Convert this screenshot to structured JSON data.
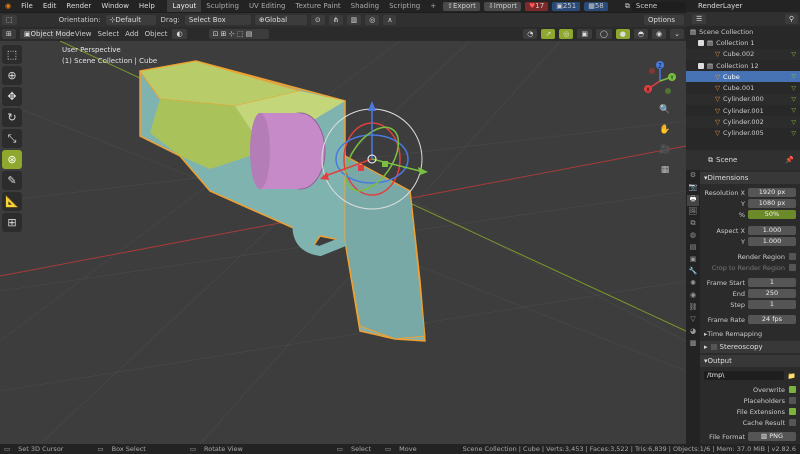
{
  "topbar": {
    "menus": [
      "File",
      "Edit",
      "Render",
      "Window",
      "Help"
    ],
    "workspaces": [
      "Layout",
      "Sculpting",
      "UV Editing",
      "Texture Paint",
      "Shading",
      "Scripting"
    ],
    "active_workspace": "Layout",
    "export_label": "Export",
    "import_label": "Import",
    "stats": [
      "17",
      "251",
      "58"
    ],
    "scene_label": "Scene",
    "view_layer_label": "RenderLayer"
  },
  "header1": {
    "orientation_label": "Orientation:",
    "orientation_value": "Default",
    "drag_label": "Drag:",
    "drag_value": "Select Box",
    "transform_value": "Global",
    "options_label": "Options"
  },
  "header2": {
    "mode": "Object Mode",
    "menus": [
      "View",
      "Select",
      "Add",
      "Object"
    ]
  },
  "viewport": {
    "perspective": "User Perspective",
    "context": "(1) Scene Collection | Cube",
    "gizmo_labels": {
      "x": "X",
      "y": "Y",
      "z": "Z"
    }
  },
  "outliner": {
    "header": "Scene Collection",
    "rows": [
      {
        "label": "Collection 1",
        "type": "collection",
        "indent": 1
      },
      {
        "label": "Cube.002",
        "type": "mesh",
        "indent": 2
      },
      {
        "label": "Collection 12",
        "type": "collection",
        "indent": 1
      },
      {
        "label": "Cube",
        "type": "mesh",
        "indent": 2,
        "selected": true
      },
      {
        "label": "Cube.001",
        "type": "mesh",
        "indent": 2
      },
      {
        "label": "Cylinder.000",
        "type": "mesh",
        "indent": 2
      },
      {
        "label": "Cylinder.001",
        "type": "mesh",
        "indent": 2
      },
      {
        "label": "Cylinder.002",
        "type": "mesh",
        "indent": 2
      },
      {
        "label": "Cylinder.005",
        "type": "mesh",
        "indent": 2
      }
    ]
  },
  "properties": {
    "context": "Scene",
    "dimensions_title": "Dimensions",
    "resolution_x_label": "Resolution X",
    "resolution_x": "1920 px",
    "resolution_y_label": "Y",
    "resolution_y": "1080 px",
    "percent_label": "%",
    "percent": "50%",
    "aspect_x_label": "Aspect X",
    "aspect_x": "1.000",
    "aspect_y_label": "Y",
    "aspect_y": "1.000",
    "render_region_label": "Render Region",
    "crop_label": "Crop to Render Region",
    "frame_start_label": "Frame Start",
    "frame_start": "1",
    "end_label": "End",
    "end": "250",
    "step_label": "Step",
    "step": "1",
    "frame_rate_label": "Frame Rate",
    "frame_rate": "24 fps",
    "time_remap_label": "Time Remapping",
    "stereoscopy_label": "Stereoscopy",
    "output_title": "Output",
    "output_path": "/tmp\\",
    "overwrite_label": "Overwrite",
    "placeholders_label": "Placeholders",
    "file_ext_label": "File Extensions",
    "cache_label": "Cache Result",
    "file_format_label": "File Format",
    "file_format": "PNG"
  },
  "statusbar": {
    "left": [
      "Set 3D Cursor",
      "Box Select",
      "Rotate View",
      "Select",
      "Move"
    ],
    "right": "Scene Collection | Cube | Verts:3,453 | Faces:3,522 | Tris:6,839 | Objects:1/6 | Mem: 37.0 MiB | v2.82.6"
  },
  "colors": {
    "accent": "#8ea82d",
    "selection": "#4772b3",
    "outline": "#f0a030",
    "gun_body": "#7fb3b0",
    "gun_top": "#b8cc6a",
    "cylinder": "#c58ac7"
  }
}
